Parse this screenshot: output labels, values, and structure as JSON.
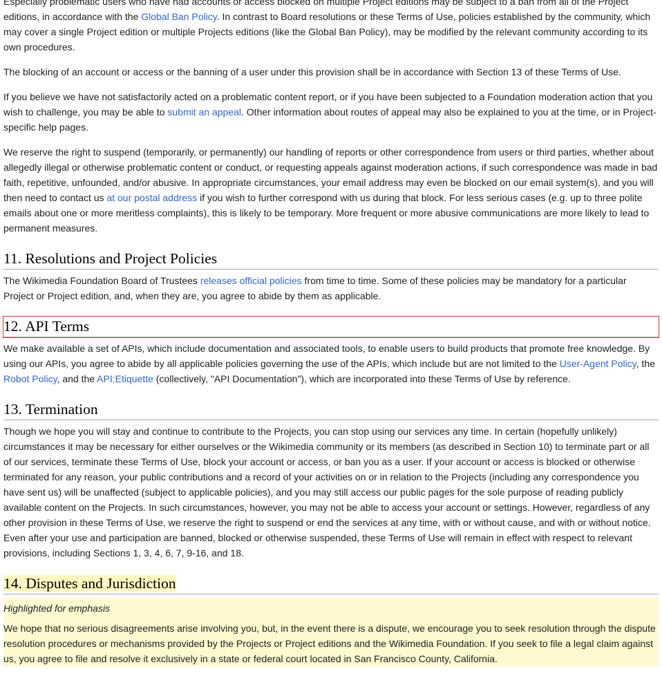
{
  "section10_tail": {
    "p1": {
      "t1": "Especially problematic users who have had accounts or access blocked on multiple Project editions may be subject to a ban from all of the Project editions, in accordance with the ",
      "link1": "Global Ban Policy",
      "t2": ". In contrast to Board resolutions or these Terms of Use, policies established by the community, which may cover a single Project edition or multiple Projects editions (like the Global Ban Policy), may be modified by the relevant community according to its own procedures."
    },
    "p2": "The blocking of an account or access or the banning of a user under this provision shall be in accordance with Section 13 of these Terms of Use.",
    "p3": {
      "t1": "If you believe we have not satisfactorily acted on a problematic content report, or if you have been subjected to a Foundation moderation action that you wish to challenge, you may be able to ",
      "link1": "submit an appeal",
      "t2": ".  Other information about routes of appeal may also be explained to you at the time, or in Project-specific help pages."
    },
    "p4": {
      "t1": "We reserve the right to suspend (temporarily, or permanently) our handling of reports or other correspondence from users or third parties, whether about allegedly illegal or otherwise problematic content or conduct, or requesting appeals against moderation actions, if such correspondence was made in bad faith, repetitive, unfounded, and/or abusive. In appropriate circumstances, your email address may even be blocked on our email system(s), and you will then need to contact us ",
      "link1": "at our postal address",
      "t2": " if you wish to further correspond with us during that block. For less serious cases (e.g. up to three polite emails about one or more meritless complaints), this is likely to be temporary. More frequent or more abusive communications are more likely to lead to permanent measures."
    }
  },
  "section11": {
    "heading": "11. Resolutions and Project Policies",
    "p1": {
      "t1": "The Wikimedia Foundation Board of Trustees ",
      "link1": "releases official policies",
      "t2": " from time to time. Some of these policies may be mandatory for a particular Project or Project edition, and, when they are, you agree to abide by them as applicable."
    }
  },
  "section12": {
    "heading": "12. API Terms",
    "p1": {
      "t1": "We make available a set of APIs, which include documentation and associated tools, to enable users to build products that promote free knowledge. By using our APIs, you agree to abide by all applicable policies governing the use of the APIs, which include but are not limited to the ",
      "link1": "User-Agent Policy",
      "t2": ", the ",
      "link2": "Robot Policy",
      "t3": ", and the ",
      "link3": "API:Etiquette",
      "t4": " (collectively, \"API Documentation\"), which are incorporated into these Terms of Use by reference."
    }
  },
  "section13": {
    "heading": "13. Termination",
    "p1": "Though we hope you will stay and continue to contribute to the Projects, you can stop using our services any time. In certain (hopefully unlikely) circumstances it may be necessary for either ourselves or the Wikimedia community or its members (as described in Section 10) to terminate part or all of our services, terminate these Terms of Use, block your account or access, or ban you as a user. If your account or access is blocked or otherwise terminated for any reason, your public contributions and a record of your activities on or in relation to the Projects (including any correspondence you have sent us) will be unaffected (subject to applicable policies), and you may still access our public pages for the sole purpose of reading publicly available content on the Projects. In such circumstances, however, you may not be able to access your account or settings. However, regardless of any other provision in these Terms of Use, we reserve the right to suspend or end the services at any time, with or without cause, and with or without notice. Even after your use and participation are banned, blocked or otherwise suspended, these Terms of Use will remain in effect with respect to relevant provisions, including Sections 1, 3, 4, 6, 7, 9-16, and 18."
  },
  "section14": {
    "heading": "14. Disputes and Jurisdiction",
    "note": "Highlighted for emphasis",
    "p1": "We hope that no serious disagreements arise involving you, but, in the event there is a dispute, we encourage you to seek resolution through the dispute resolution procedures or mechanisms provided by the Projects or Project editions and the Wikimedia Foundation. If you seek to file a legal claim against us, you agree to file and resolve it exclusively in a state or federal court located in San Francisco County, California."
  },
  "colors": {
    "link": "#3366cc",
    "text": "#202122",
    "highlight": "#fef9cf",
    "selection_outline": "#dd3333"
  }
}
